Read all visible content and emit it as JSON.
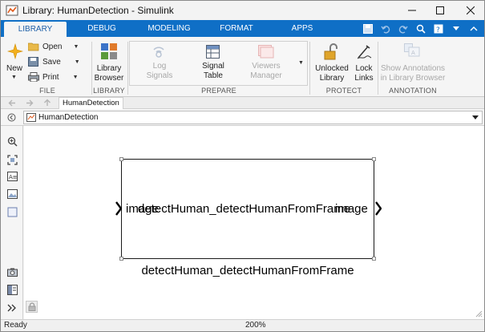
{
  "window": {
    "title": "Library: HumanDetection - Simulink"
  },
  "tabs": [
    "LIBRARY",
    "DEBUG",
    "MODELING",
    "FORMAT",
    "APPS"
  ],
  "ribbon": {
    "file": {
      "new_label": "New",
      "open_label": "Open",
      "save_label": "Save",
      "print_label": "Print",
      "group_title": "FILE"
    },
    "library": {
      "browser_label_1": "Library",
      "browser_label_2": "Browser",
      "group_title": "LIBRARY"
    },
    "prepare": {
      "log_signals_1": "Log",
      "log_signals_2": "Signals",
      "signal_table_1": "Signal",
      "signal_table_2": "Table",
      "viewers_manager_1": "Viewers",
      "viewers_manager_2": "Manager",
      "group_title": "PREPARE"
    },
    "protect": {
      "unlocked_library_1": "Unlocked",
      "unlocked_library_2": "Library",
      "lock_links_1": "Lock",
      "lock_links_2": "Links",
      "group_title": "PROTECT"
    },
    "annotation": {
      "show_annotations_1": "Show Annotations",
      "show_annotations_2": "in Library Browser",
      "group_title": "ANNOTATION"
    }
  },
  "breadcrumb": {
    "tab_label": "HumanDetection"
  },
  "address": {
    "path": "HumanDetection"
  },
  "block": {
    "input_port": "image",
    "output_port": "image",
    "center_label": "detectHuman_detectHumanFromFrame",
    "name": "detectHuman_detectHumanFromFrame"
  },
  "status": {
    "state": "Ready",
    "zoom": "200%"
  },
  "colors": {
    "tab_strip": "#0f6fc6",
    "active_tab_text": "#1d5fa8"
  }
}
